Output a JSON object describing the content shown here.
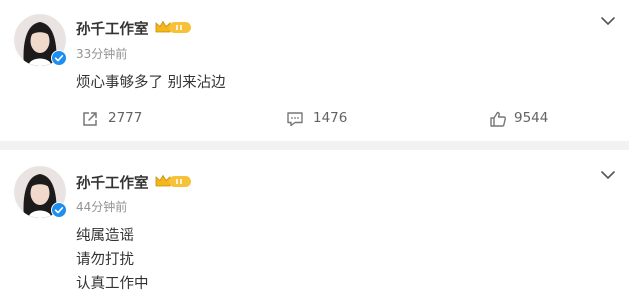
{
  "posts": [
    {
      "author": "孙千工作室",
      "time": "33分钟前",
      "content": [
        "烦心事够多了 别来沾边"
      ],
      "actions": {
        "repost_count": "2777",
        "comment_count": "1476",
        "like_count": "9544"
      }
    },
    {
      "author": "孙千工作室",
      "time": "44分钟前",
      "content": [
        "纯属造谣",
        "请勿打扰",
        "认真工作中"
      ]
    }
  ],
  "icons": {
    "verified": "verified-badge-icon",
    "member": "crown-member-icon",
    "more": "chevron-down-icon",
    "repost": "repost-icon",
    "comment": "comment-icon",
    "like": "thumbs-up-icon"
  },
  "colors": {
    "verified_blue": "#1f8ef1",
    "crown_gold": "#f3b61c",
    "muted_text": "#939393",
    "separator": "#f2f2f2"
  }
}
